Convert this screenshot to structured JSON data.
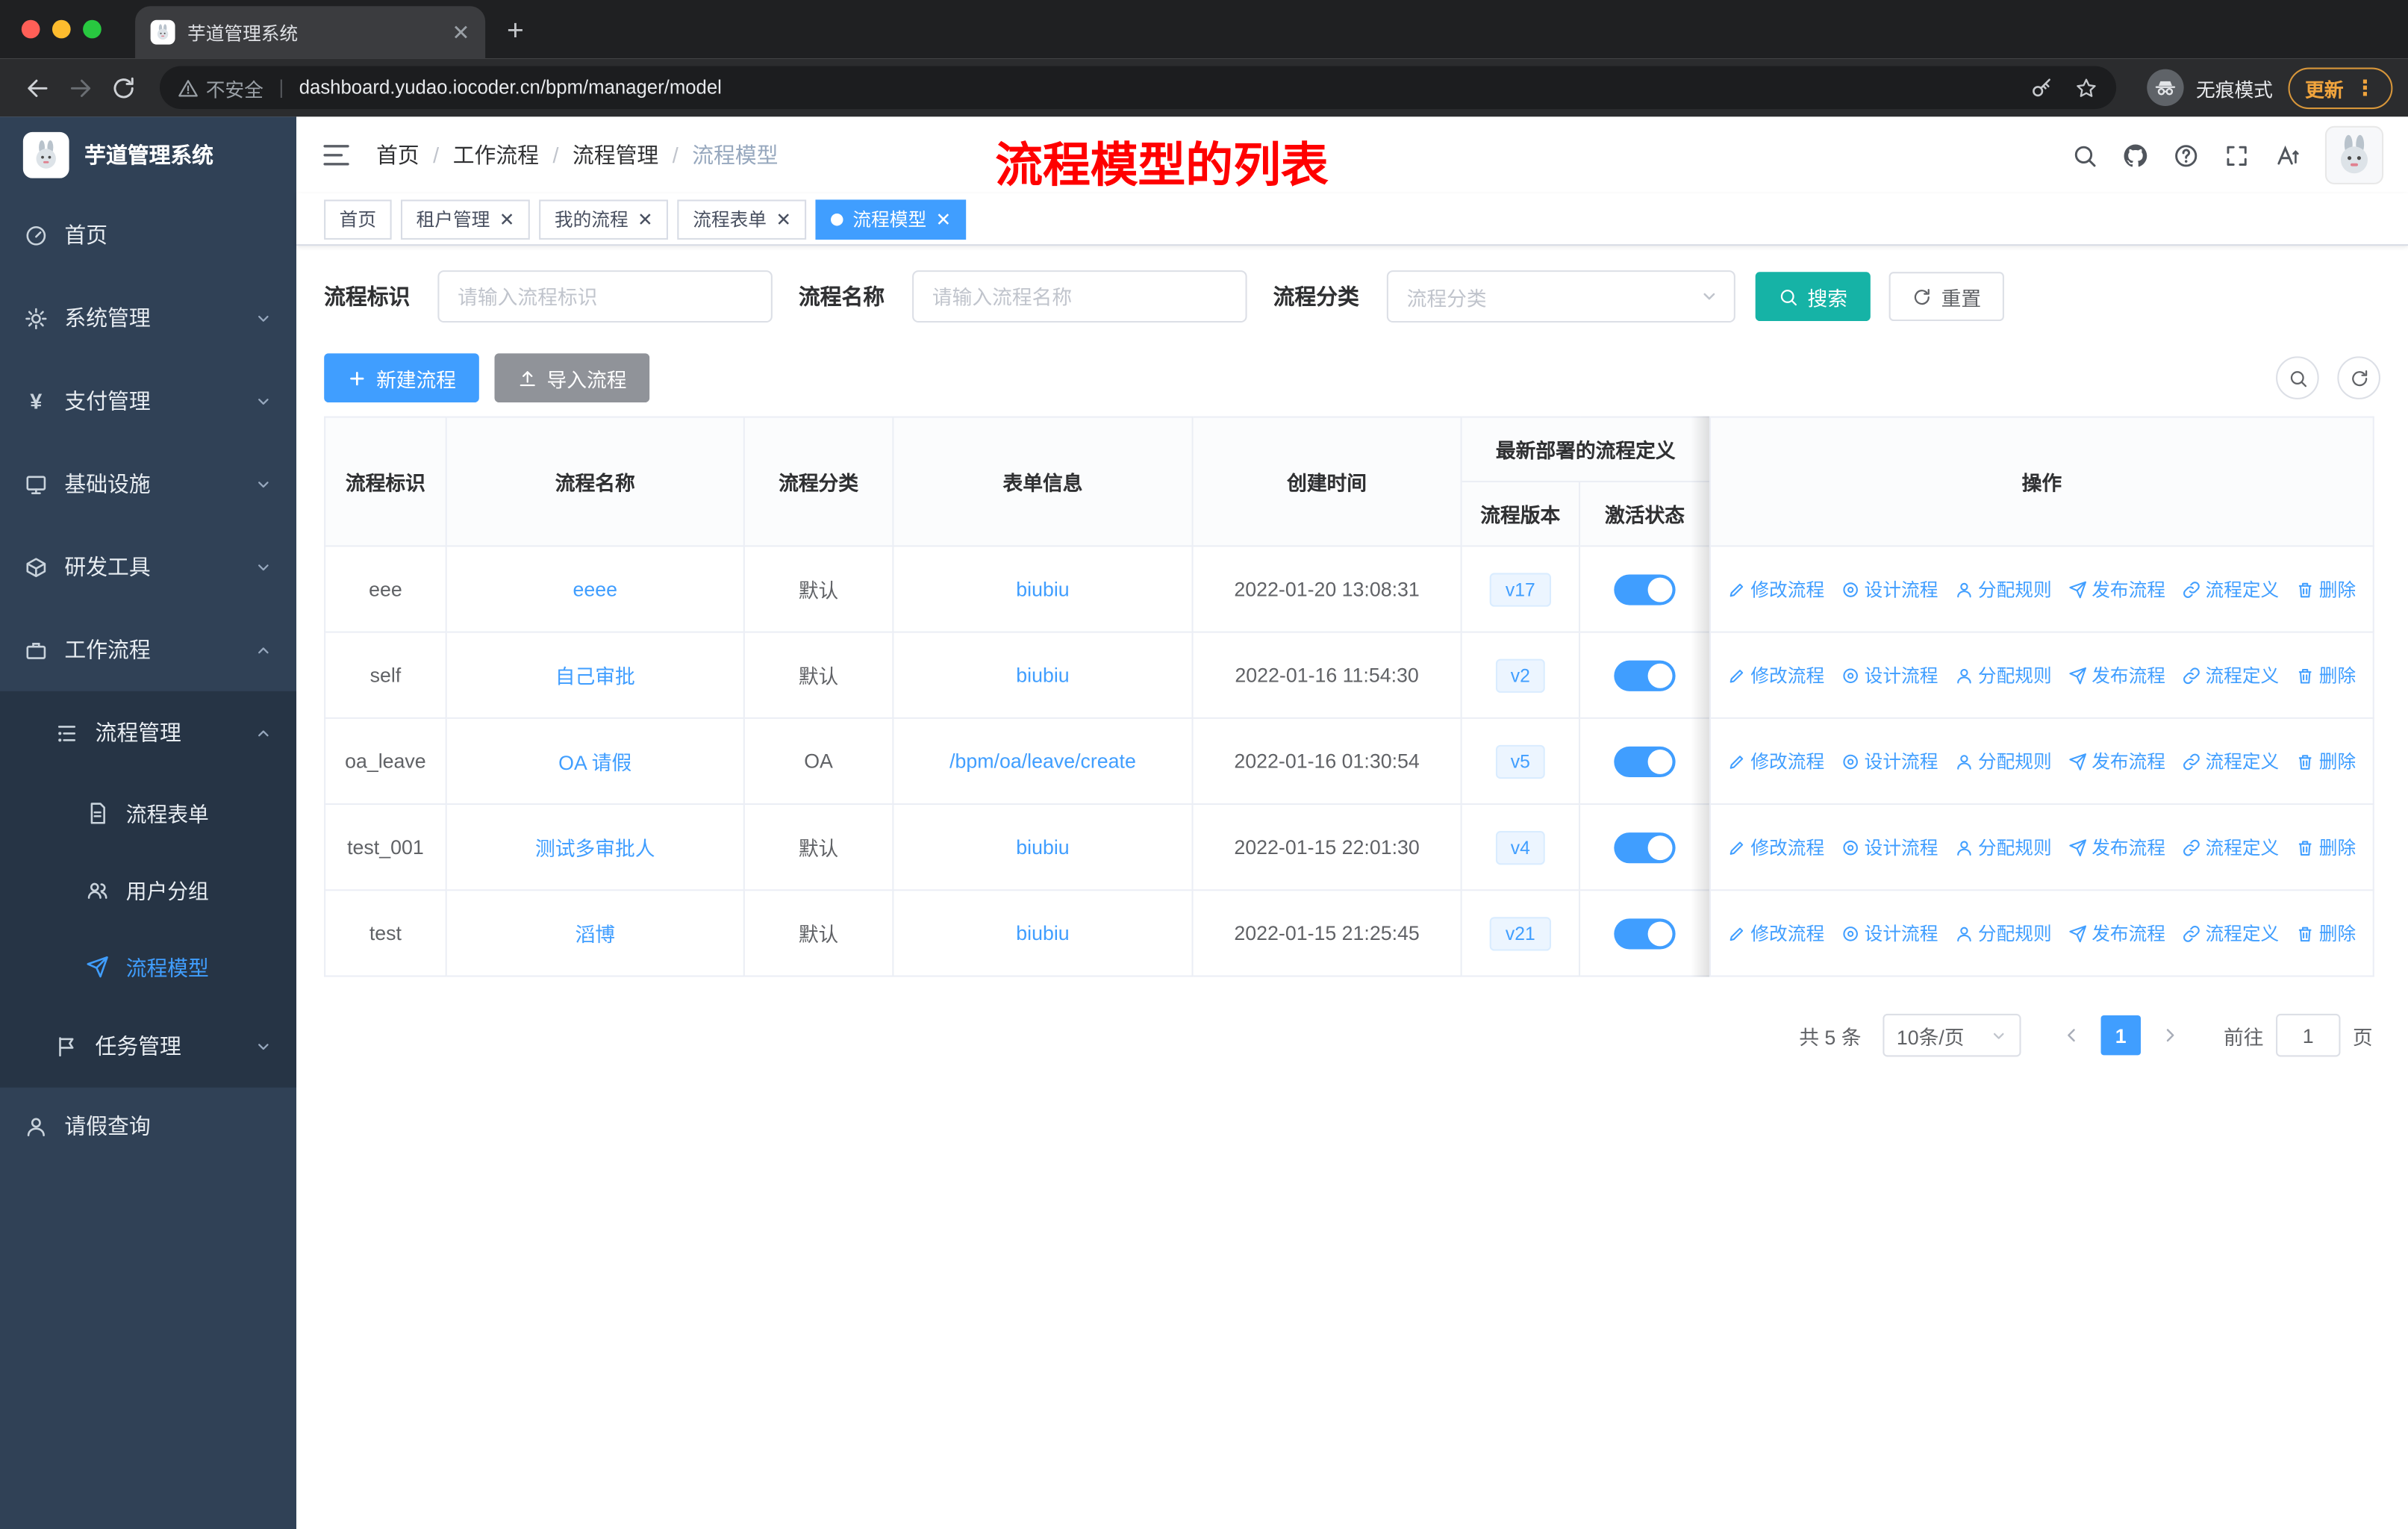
{
  "browser": {
    "tab_title": "芋道管理系统",
    "security_label": "不安全",
    "url": "dashboard.yudao.iocoder.cn/bpm/manager/model",
    "incognito_label": "无痕模式",
    "update_label": "更新"
  },
  "sidebar": {
    "app_title": "芋道管理系统",
    "items": {
      "home": "首页",
      "system": "系统管理",
      "payment": "支付管理",
      "infra": "基础设施",
      "devtools": "研发工具",
      "workflow": "工作流程",
      "process_mgmt": "流程管理",
      "process_form": "流程表单",
      "user_group": "用户分组",
      "process_model": "流程模型",
      "task_mgmt": "任务管理",
      "leave_query": "请假查询"
    }
  },
  "navbar": {
    "breadcrumb": [
      "首页",
      "工作流程",
      "流程管理",
      "流程模型"
    ],
    "annotation": "流程模型的列表"
  },
  "tags": [
    {
      "label": "首页"
    },
    {
      "label": "租户管理"
    },
    {
      "label": "我的流程"
    },
    {
      "label": "流程表单"
    },
    {
      "label": "流程模型"
    }
  ],
  "filters": {
    "key_label": "流程标识",
    "key_placeholder": "请输入流程标识",
    "name_label": "流程名称",
    "name_placeholder": "请输入流程名称",
    "category_label": "流程分类",
    "category_placeholder": "流程分类",
    "search_label": "搜索",
    "reset_label": "重置"
  },
  "toolbar": {
    "create_label": "新建流程",
    "import_label": "导入流程"
  },
  "table": {
    "headers": {
      "key": "流程标识",
      "name": "流程名称",
      "category": "流程分类",
      "form": "表单信息",
      "created": "创建时间",
      "deployment": "最新部署的流程定义",
      "version": "流程版本",
      "active": "激活状态",
      "ops": "操作"
    },
    "actions": [
      "修改流程",
      "设计流程",
      "分配规则",
      "发布流程",
      "流程定义",
      "删除"
    ],
    "rows": [
      {
        "key": "eee",
        "name": "eeee",
        "category": "默认",
        "form": "biubiu",
        "created": "2022-01-20 13:08:31",
        "version": "v17",
        "active": true
      },
      {
        "key": "self",
        "name": "自己审批",
        "category": "默认",
        "form": "biubiu",
        "created": "2022-01-16 11:54:30",
        "version": "v2",
        "active": true
      },
      {
        "key": "oa_leave",
        "name": "OA 请假",
        "category": "OA",
        "form": "/bpm/oa/leave/create",
        "created": "2022-01-16 01:30:54",
        "version": "v5",
        "active": true
      },
      {
        "key": "test_001",
        "name": "测试多审批人",
        "category": "默认",
        "form": "biubiu",
        "created": "2022-01-15 22:01:30",
        "version": "v4",
        "active": true
      },
      {
        "key": "test",
        "name": "滔博",
        "category": "默认",
        "form": "biubiu",
        "created": "2022-01-15 21:25:45",
        "version": "v21",
        "active": true
      }
    ]
  },
  "pagination": {
    "total": "共 5 条",
    "page_size": "10条/页",
    "current_page": "1",
    "goto_label": "前往",
    "goto_value": "1",
    "page_unit": "页"
  },
  "colors": {
    "accent": "#409eff",
    "sidebar_bg": "#304156",
    "search_button": "#16b3a6",
    "annotation": "#ff0000"
  }
}
